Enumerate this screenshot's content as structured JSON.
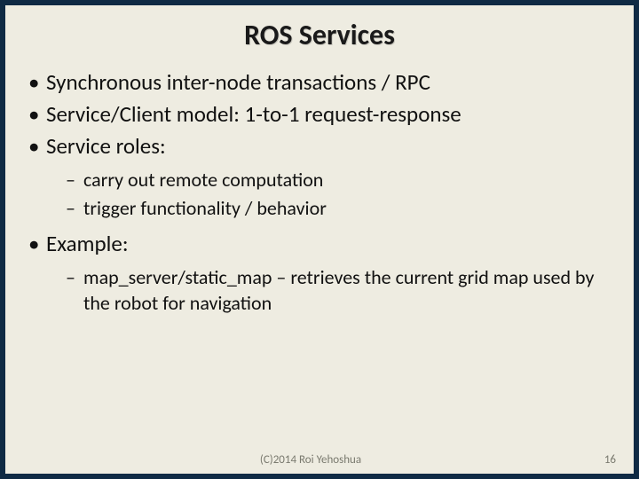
{
  "slide": {
    "title": "ROS Services",
    "bullets": {
      "b1": "Synchronous inter-node transactions / RPC",
      "b2": "Service/Client model: 1-to-1 request-response",
      "b3": "Service roles:",
      "b3_sub": {
        "s1": "carry out remote computation",
        "s2": "trigger functionality / behavior"
      },
      "b4": "Example:",
      "b4_sub": {
        "s1": "map_server/static_map – retrieves the current grid map used by the robot for navigation"
      }
    },
    "footer": {
      "copyright": "(C)2014 Roi Yehoshua",
      "page_number": "16"
    }
  }
}
